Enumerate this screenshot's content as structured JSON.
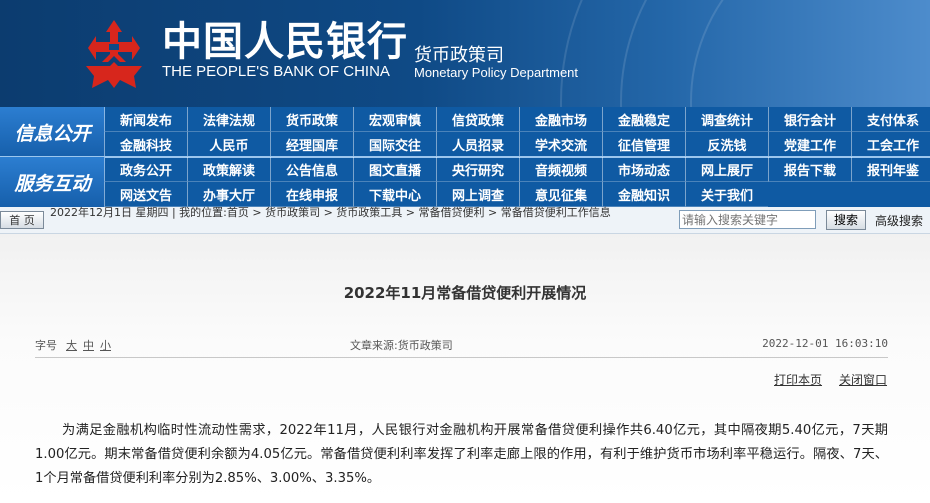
{
  "header": {
    "cn_name": "中国人民银行",
    "en_name": "THE PEOPLE'S BANK OF CHINA",
    "dept_cn": "货币政策司",
    "dept_en": "Monetary Policy Department",
    "colors": {
      "banner": "#0f4a86",
      "logo_red": "#d7261c"
    }
  },
  "nav": {
    "info_label": "信息公开",
    "service_label": "服务互动",
    "info_row1": [
      "新闻发布",
      "法律法规",
      "货币政策",
      "宏观审慎",
      "信贷政策",
      "金融市场",
      "金融稳定",
      "调查统计",
      "银行会计",
      "支付体系"
    ],
    "info_row2": [
      "金融科技",
      "人民币",
      "经理国库",
      "国际交往",
      "人员招录",
      "学术交流",
      "征信管理",
      "反洗钱",
      "党建工作",
      "工会工作"
    ],
    "svc_row1": [
      "政务公开",
      "政策解读",
      "公告信息",
      "图文直播",
      "央行研究",
      "音频视频",
      "市场动态",
      "网上展厅",
      "报告下载",
      "报刊年鉴"
    ],
    "svc_row2": [
      "网送文告",
      "办事大厅",
      "在线申报",
      "下载中心",
      "网上调查",
      "意见征集",
      "金融知识",
      "关于我们"
    ]
  },
  "breadcrumb": {
    "home": "首 页",
    "text": "2022年12月1日 星期四 | 我的位置:首页 > 货币政策司 > 货币政策工具 > 常备借贷便利 > 常备借贷便利工作信息"
  },
  "search": {
    "placeholder": "请输入搜索关键字",
    "button": "搜索",
    "advanced": "高级搜索"
  },
  "article": {
    "title": "2022年11月常备借贷便利开展情况",
    "size_label": "字号",
    "size_large": "大",
    "size_medium": "中",
    "size_small": "小",
    "source": "文章来源:货币政策司",
    "datetime": "2022-12-01 16:03:10",
    "print": "打印本页",
    "close": "关闭窗口",
    "body": "为满足金融机构临时性流动性需求，2022年11月，人民银行对金融机构开展常备借贷便利操作共6.40亿元，其中隔夜期5.40亿元，7天期1.00亿元。期末常备借贷便利余额为4.05亿元。常备借贷便利利率发挥了利率走廊上限的作用，有利于维护货币市场利率平稳运行。隔夜、7天、1个月常备借贷便利利率分别为2.85%、3.00%、3.35%。"
  }
}
